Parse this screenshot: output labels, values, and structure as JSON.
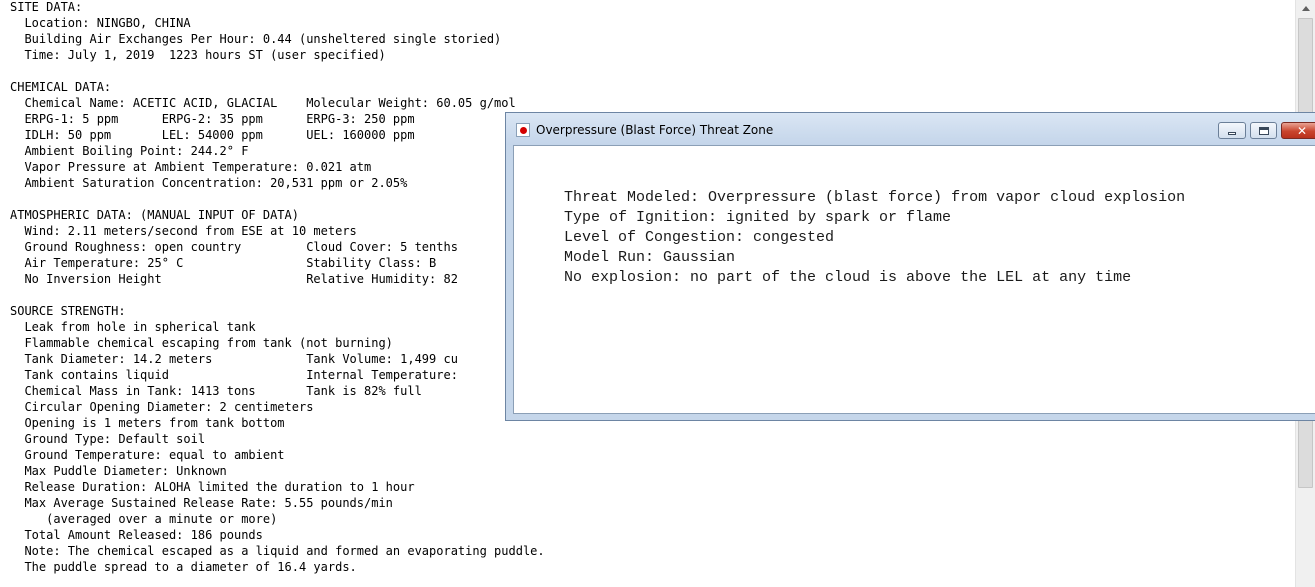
{
  "report": {
    "lines": [
      "SITE DATA:",
      "  Location: NINGBO, CHINA",
      "  Building Air Exchanges Per Hour: 0.44 (unsheltered single storied)",
      "  Time: July 1, 2019  1223 hours ST (user specified)",
      "",
      "CHEMICAL DATA:",
      "  Chemical Name: ACETIC ACID, GLACIAL    Molecular Weight: 60.05 g/mol",
      "  ERPG-1: 5 ppm      ERPG-2: 35 ppm      ERPG-3: 250 ppm",
      "  IDLH: 50 ppm       LEL: 54000 ppm      UEL: 160000 ppm",
      "  Ambient Boiling Point: 244.2° F",
      "  Vapor Pressure at Ambient Temperature: 0.021 atm",
      "  Ambient Saturation Concentration: 20,531 ppm or 2.05%",
      "",
      "ATMOSPHERIC DATA: (MANUAL INPUT OF DATA)",
      "  Wind: 2.11 meters/second from ESE at 10 meters",
      "  Ground Roughness: open country         Cloud Cover: 5 tenths",
      "  Air Temperature: 25° C                 Stability Class: B",
      "  No Inversion Height                    Relative Humidity: 82",
      "",
      "SOURCE STRENGTH:",
      "  Leak from hole in spherical tank",
      "  Flammable chemical escaping from tank (not burning)",
      "  Tank Diameter: 14.2 meters             Tank Volume: 1,499 cu",
      "  Tank contains liquid                   Internal Temperature:",
      "  Chemical Mass in Tank: 1413 tons       Tank is 82% full",
      "  Circular Opening Diameter: 2 centimeters",
      "  Opening is 1 meters from tank bottom",
      "  Ground Type: Default soil",
      "  Ground Temperature: equal to ambient",
      "  Max Puddle Diameter: Unknown",
      "  Release Duration: ALOHA limited the duration to 1 hour",
      "  Max Average Sustained Release Rate: 5.55 pounds/min",
      "     (averaged over a minute or more)",
      "  Total Amount Released: 186 pounds",
      "  Note: The chemical escaped as a liquid and formed an evaporating puddle.",
      "  The puddle spread to a diameter of 16.4 yards."
    ]
  },
  "dialog": {
    "title": "Overpressure (Blast Force) Threat Zone",
    "app_icon": "aloha-app-icon",
    "lines": [
      "Threat Modeled: Overpressure (blast force) from vapor cloud explosion",
      "Type of Ignition: ignited by spark or flame",
      "Level of Congestion: congested",
      "Model Run: Gaussian",
      "No explosion: no part of the cloud is above the LEL at any time"
    ],
    "buttons": {
      "minimize_icon": "minimize-icon",
      "maximize_icon": "maximize-icon",
      "close_icon": "close-icon",
      "close_glyph": "✕"
    }
  }
}
